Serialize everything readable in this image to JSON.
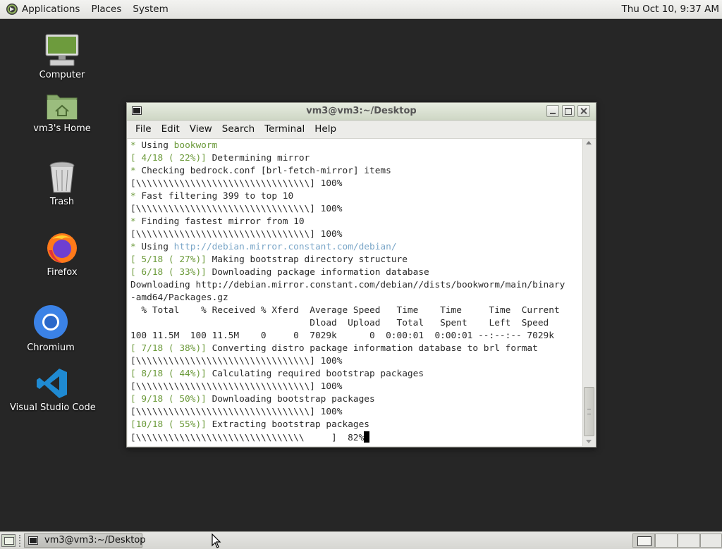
{
  "top_panel": {
    "menus": [
      "Applications",
      "Places",
      "System"
    ],
    "clock": "Thu Oct 10,  9:37 AM"
  },
  "desktop_icons": [
    {
      "label": "Computer",
      "icon": "computer-icon"
    },
    {
      "label": "vm3's Home",
      "icon": "home-folder-icon"
    },
    {
      "label": "Trash",
      "icon": "trash-icon"
    },
    {
      "label": "Firefox",
      "icon": "firefox-icon"
    },
    {
      "label": "Chromium",
      "icon": "chromium-icon"
    },
    {
      "label": "Visual Studio Code",
      "icon": "vscode-icon"
    }
  ],
  "terminal": {
    "title": "vm3@vm3:~/Desktop",
    "menu": [
      "File",
      "Edit",
      "View",
      "Search",
      "Terminal",
      "Help"
    ],
    "lines": [
      [
        "* Using ",
        "bookworm"
      ],
      [
        "[ 4/18 ( 22%)]",
        " Determining mirror"
      ],
      [
        "* Checking bedrock.conf [brl-fetch-mirror] items"
      ],
      [
        "[\\\\\\\\\\\\\\\\\\\\\\\\\\\\\\\\\\\\\\\\\\\\\\\\\\\\\\\\\\\\\\\\] 100%"
      ],
      [
        "* Fast filtering 399 to top 10"
      ],
      [
        "[\\\\\\\\\\\\\\\\\\\\\\\\\\\\\\\\\\\\\\\\\\\\\\\\\\\\\\\\\\\\\\\\] 100%"
      ],
      [
        "* Finding fastest mirror from 10"
      ],
      [
        "[\\\\\\\\\\\\\\\\\\\\\\\\\\\\\\\\\\\\\\\\\\\\\\\\\\\\\\\\\\\\\\\\] 100%"
      ],
      [
        "* Using ",
        "http://debian.mirror.constant.com/debian/"
      ],
      [
        "[ 5/18 ( 27%)]",
        " Making bootstrap directory structure"
      ],
      [
        "[ 6/18 ( 33%)]",
        " Downloading package information database"
      ],
      [
        "Downloading http://debian.mirror.constant.com/debian//dists/bookworm/main/binary"
      ],
      [
        "-amd64/Packages.gz"
      ],
      [
        "  % Total    % Received % Xferd  Average Speed   Time    Time     Time  Current"
      ],
      [
        "                                 Dload  Upload   Total   Spent    Left  Speed"
      ],
      [
        "100 11.5M  100 11.5M    0     0  7029k      0  0:00:01  0:00:01 --:--:-- 7029k"
      ],
      [
        "[ 7/18 ( 38%)]",
        " Converting distro package information database to brl format"
      ],
      [
        "[\\\\\\\\\\\\\\\\\\\\\\\\\\\\\\\\\\\\\\\\\\\\\\\\\\\\\\\\\\\\\\\\] 100%"
      ],
      [
        "[ 8/18 ( 44%)]",
        " Calculating required bootstrap packages"
      ],
      [
        "[\\\\\\\\\\\\\\\\\\\\\\\\\\\\\\\\\\\\\\\\\\\\\\\\\\\\\\\\\\\\\\\\] 100%"
      ],
      [
        "[ 9/18 ( 50%)]",
        " Downloading bootstrap packages"
      ],
      [
        "[\\\\\\\\\\\\\\\\\\\\\\\\\\\\\\\\\\\\\\\\\\\\\\\\\\\\\\\\\\\\\\\\] 100%"
      ],
      [
        "[10/18 ( 55%)]",
        " Extracting bootstrap packages"
      ],
      [
        "[\\\\\\\\\\\\\\\\\\\\\\\\\\\\\\\\\\\\\\\\\\\\\\\\\\\\\\\\\\\\\\     ]  82%"
      ]
    ]
  },
  "taskbar": {
    "window_button": "vm3@vm3:~/Desktop",
    "workspaces": 4
  },
  "colors": {
    "desktop_bg": "#262626",
    "terminal_green": "#6b9a3a",
    "terminal_link": "#7aa6c8"
  }
}
